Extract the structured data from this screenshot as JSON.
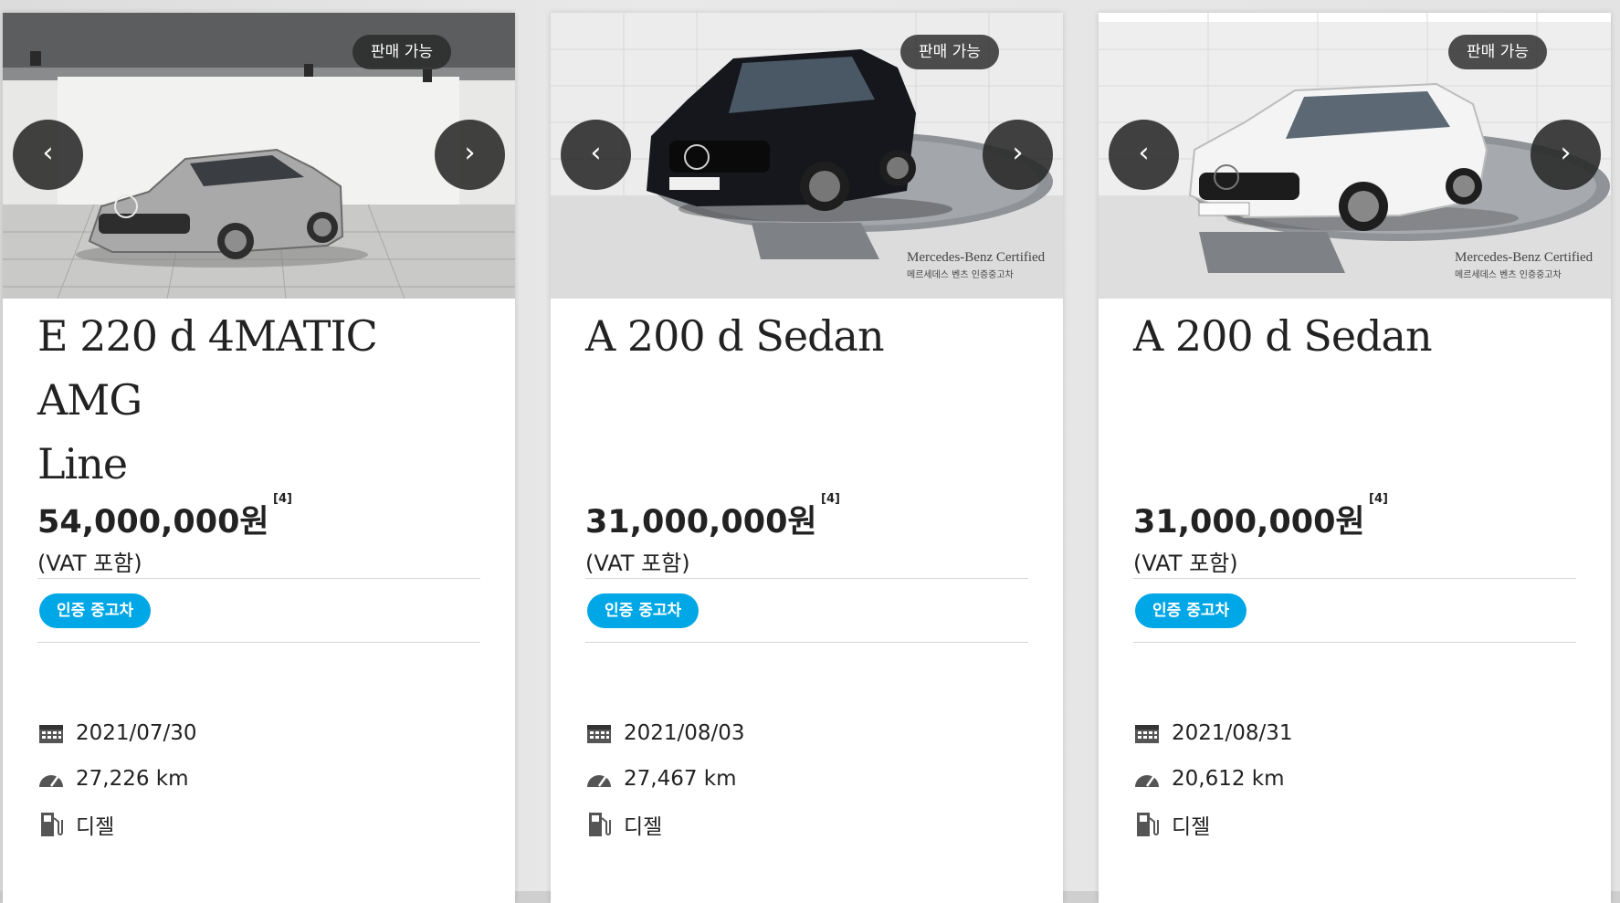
{
  "cards": [
    {
      "badge": "판매 가능",
      "prev_symbol": "‹",
      "next_symbol": "›",
      "title_line1": "E 220 d 4MATIC AMG",
      "title_line2": "Line",
      "price": "54,000,000원",
      "footnote": "[4]",
      "vat": "(VAT 포함)",
      "tag": "인증 중고차",
      "date": "2021/07/30",
      "mileage": "27,226 km",
      "fuel": "디젤",
      "car_color": "#a9a9a9"
    },
    {
      "badge": "판매 가능",
      "prev_symbol": "‹",
      "next_symbol": "›",
      "title_line1": "A 200 d Sedan",
      "title_line2": "",
      "price": "31,000,000원",
      "footnote": "[4]",
      "vat": "(VAT 포함)",
      "tag": "인증 중고차",
      "date": "2021/08/03",
      "mileage": "27,467 km",
      "fuel": "디젤",
      "car_color": "#15171c",
      "watermark_line1": "Mercedes-Benz Certified",
      "watermark_line2": "메르세데스 벤츠 인증중고차"
    },
    {
      "badge": "판매 가능",
      "prev_symbol": "‹",
      "next_symbol": "›",
      "title_line1": "A 200 d Sedan",
      "title_line2": "",
      "price": "31,000,000원",
      "footnote": "[4]",
      "vat": "(VAT 포함)",
      "tag": "인증 중고차",
      "date": "2021/08/31",
      "mileage": "20,612 km",
      "fuel": "디젤",
      "car_color": "#f4f4f4",
      "watermark_line1": "Mercedes-Benz Certified",
      "watermark_line2": "메르세데스 벤츠 인증중고차"
    }
  ],
  "icons": {
    "date": "calendar-icon",
    "mileage": "speedometer-icon",
    "fuel": "fuel-pump-icon"
  }
}
